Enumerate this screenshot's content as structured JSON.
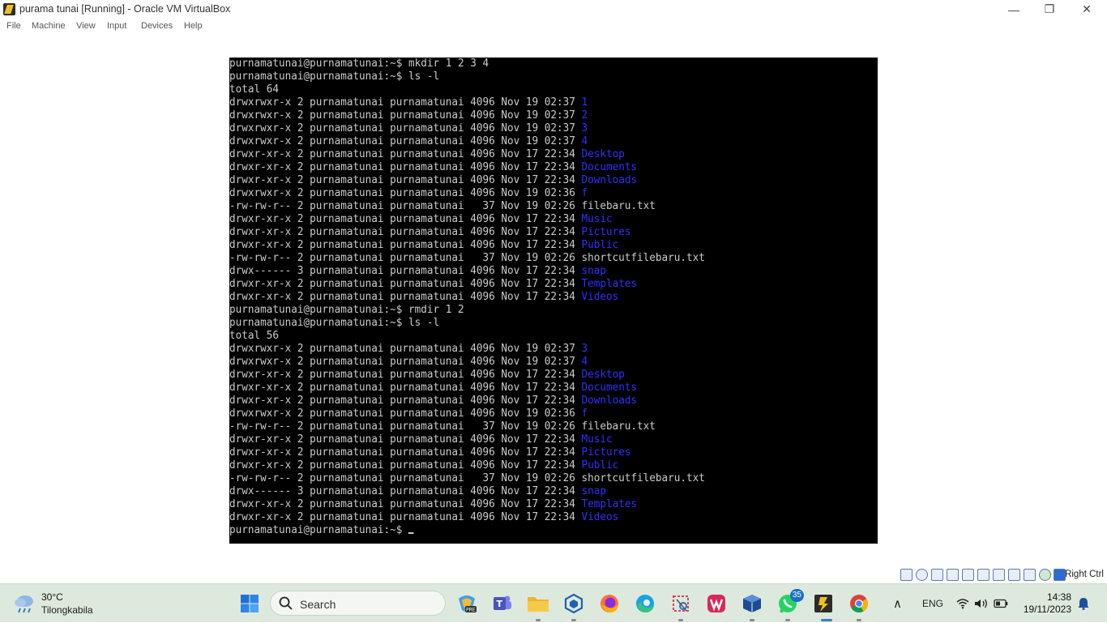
{
  "window": {
    "title": "purama tunai [Running] - Oracle VM VirtualBox",
    "minimize_glyph": "—",
    "restore_glyph": "❐",
    "close_glyph": "✕"
  },
  "menu": [
    "File",
    "Machine",
    "View",
    "Input",
    "Devices",
    "Help"
  ],
  "terminal": {
    "lines": [
      {
        "text": "purnamatunai@purnamatunai:~$ mkdir 1 2 3 4"
      },
      {
        "text": "purnamatunai@purnamatunai:~$ ls -l"
      },
      {
        "text": "total 64"
      },
      {
        "text": "drwxrwxr-x 2 purnamatunai purnamatunai 4096 Nov 19 02:37 ",
        "dir": "1"
      },
      {
        "text": "drwxrwxr-x 2 purnamatunai purnamatunai 4096 Nov 19 02:37 ",
        "dir": "2"
      },
      {
        "text": "drwxrwxr-x 2 purnamatunai purnamatunai 4096 Nov 19 02:37 ",
        "dir": "3"
      },
      {
        "text": "drwxrwxr-x 2 purnamatunai purnamatunai 4096 Nov 19 02:37 ",
        "dir": "4"
      },
      {
        "text": "drwxr-xr-x 2 purnamatunai purnamatunai 4096 Nov 17 22:34 ",
        "dir": "Desktop"
      },
      {
        "text": "drwxr-xr-x 2 purnamatunai purnamatunai 4096 Nov 17 22:34 ",
        "dir": "Documents"
      },
      {
        "text": "drwxr-xr-x 2 purnamatunai purnamatunai 4096 Nov 17 22:34 ",
        "dir": "Downloads"
      },
      {
        "text": "drwxrwxr-x 2 purnamatunai purnamatunai 4096 Nov 19 02:36 ",
        "dir": "f"
      },
      {
        "text": "-rw-rw-r-- 2 purnamatunai purnamatunai   37 Nov 19 02:26 filebaru.txt"
      },
      {
        "text": "drwxr-xr-x 2 purnamatunai purnamatunai 4096 Nov 17 22:34 ",
        "dir": "Music"
      },
      {
        "text": "drwxr-xr-x 2 purnamatunai purnamatunai 4096 Nov 17 22:34 ",
        "dir": "Pictures"
      },
      {
        "text": "drwxr-xr-x 2 purnamatunai purnamatunai 4096 Nov 17 22:34 ",
        "dir": "Public"
      },
      {
        "text": "-rw-rw-r-- 2 purnamatunai purnamatunai   37 Nov 19 02:26 shortcutfilebaru.txt"
      },
      {
        "text": "drwx------ 3 purnamatunai purnamatunai 4096 Nov 17 22:34 ",
        "dir": "snap"
      },
      {
        "text": "drwxr-xr-x 2 purnamatunai purnamatunai 4096 Nov 17 22:34 ",
        "dir": "Templates"
      },
      {
        "text": "drwxr-xr-x 2 purnamatunai purnamatunai 4096 Nov 17 22:34 ",
        "dir": "Videos"
      },
      {
        "text": "purnamatunai@purnamatunai:~$ rmdir 1 2"
      },
      {
        "text": "purnamatunai@purnamatunai:~$ ls -l"
      },
      {
        "text": "total 56"
      },
      {
        "text": "drwxrwxr-x 2 purnamatunai purnamatunai 4096 Nov 19 02:37 ",
        "dir": "3"
      },
      {
        "text": "drwxrwxr-x 2 purnamatunai purnamatunai 4096 Nov 19 02:37 ",
        "dir": "4"
      },
      {
        "text": "drwxr-xr-x 2 purnamatunai purnamatunai 4096 Nov 17 22:34 ",
        "dir": "Desktop"
      },
      {
        "text": "drwxr-xr-x 2 purnamatunai purnamatunai 4096 Nov 17 22:34 ",
        "dir": "Documents"
      },
      {
        "text": "drwxr-xr-x 2 purnamatunai purnamatunai 4096 Nov 17 22:34 ",
        "dir": "Downloads"
      },
      {
        "text": "drwxrwxr-x 2 purnamatunai purnamatunai 4096 Nov 19 02:36 ",
        "dir": "f"
      },
      {
        "text": "-rw-rw-r-- 2 purnamatunai purnamatunai   37 Nov 19 02:26 filebaru.txt"
      },
      {
        "text": "drwxr-xr-x 2 purnamatunai purnamatunai 4096 Nov 17 22:34 ",
        "dir": "Music"
      },
      {
        "text": "drwxr-xr-x 2 purnamatunai purnamatunai 4096 Nov 17 22:34 ",
        "dir": "Pictures"
      },
      {
        "text": "drwxr-xr-x 2 purnamatunai purnamatunai 4096 Nov 17 22:34 ",
        "dir": "Public"
      },
      {
        "text": "-rw-rw-r-- 2 purnamatunai purnamatunai   37 Nov 19 02:26 shortcutfilebaru.txt"
      },
      {
        "text": "drwx------ 3 purnamatunai purnamatunai 4096 Nov 17 22:34 ",
        "dir": "snap"
      },
      {
        "text": "drwxr-xr-x 2 purnamatunai purnamatunai 4096 Nov 17 22:34 ",
        "dir": "Templates"
      },
      {
        "text": "drwxr-xr-x 2 purnamatunai purnamatunai 4096 Nov 17 22:34 ",
        "dir": "Videos"
      },
      {
        "text": "purnamatunai@purnamatunai:~$ ",
        "cursor": true
      }
    ],
    "colors": {
      "background": "#000000",
      "text": "#cccccc",
      "directory": "#3030ff"
    }
  },
  "statusbar": {
    "icons": [
      "hard-disk-icon",
      "optical-disk-icon",
      "audio-icon",
      "network-icon",
      "usb-icon",
      "shared-folder-icon",
      "display-icon",
      "recording-icon",
      "cpu-icon",
      "mouse-integration-icon",
      "keyboard-capture-icon"
    ],
    "host_key": "Right Ctrl"
  },
  "taskbar": {
    "weather": {
      "temp": "30°C",
      "location": "Tilongkabila",
      "icon": "rain-cloud-icon"
    },
    "search_label": "Search",
    "apps": [
      {
        "name": "copilot-pre-icon",
        "running": false
      },
      {
        "name": "teams-icon",
        "running": false
      },
      {
        "name": "file-explorer-icon",
        "running": true
      },
      {
        "name": "virtualbox-extension-icon",
        "running": true
      },
      {
        "name": "firefox-icon",
        "running": false
      },
      {
        "name": "edge-icon",
        "running": false
      },
      {
        "name": "snipping-tool-icon",
        "running": true
      },
      {
        "name": "wps-office-icon",
        "running": false
      },
      {
        "name": "virtualbox-icon",
        "running": true
      },
      {
        "name": "whatsapp-icon",
        "running": true,
        "badge": "35"
      },
      {
        "name": "vm-running-icon",
        "running": true
      },
      {
        "name": "chrome-icon",
        "running": true
      }
    ],
    "tray": {
      "overflow_glyph": "∧",
      "language": "ENG"
    },
    "clock": {
      "time": "14:38",
      "date": "19/11/2023"
    }
  }
}
